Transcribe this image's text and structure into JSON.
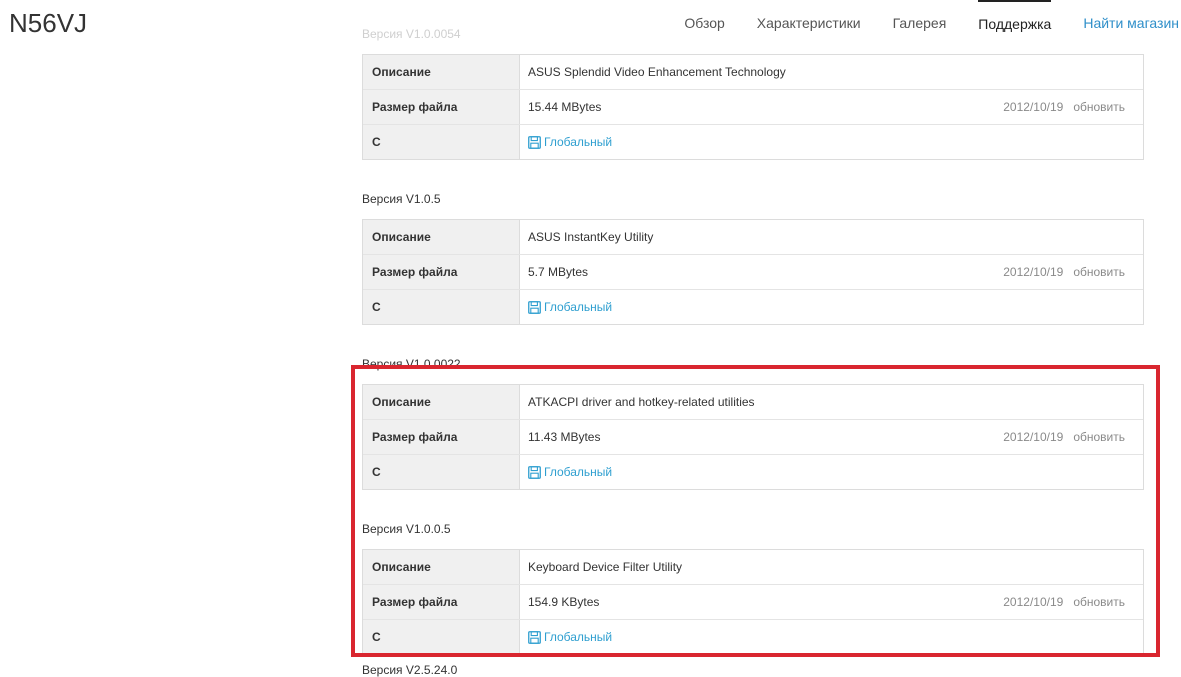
{
  "product": {
    "name": "N56VJ"
  },
  "nav": {
    "items": [
      "Обзор",
      "Характеристики",
      "Галерея",
      "Поддержка"
    ],
    "store": "Найти магазин"
  },
  "labels": {
    "description": "Описание",
    "file_size": "Размер файла",
    "c": "С",
    "global": "Глобальный",
    "update": "обновить"
  },
  "sections": [
    {
      "version": "Версия V1.0.0054",
      "description": "ASUS Splendid Video Enhancement Technology",
      "size": "15.44 MBytes",
      "date": "2012/10/19"
    },
    {
      "version": "Версия V1.0.5",
      "description": "ASUS InstantKey Utility",
      "size": "5.7 MBytes",
      "date": "2012/10/19"
    },
    {
      "version": "Версия V1.0.0022",
      "description": "ATKACPI driver and hotkey-related utilities",
      "size": "11.43 MBytes",
      "date": "2012/10/19"
    },
    {
      "version": "Версия V1.0.0.5",
      "description": "Keyboard Device Filter Utility",
      "size": "154.9 KBytes",
      "date": "2012/10/19"
    }
  ],
  "partial_next_version": "Версия V2.5.24.0",
  "colors": {
    "highlight": "#d9262f",
    "link": "#2f9fd0",
    "store_link": "#2f8fc9"
  }
}
